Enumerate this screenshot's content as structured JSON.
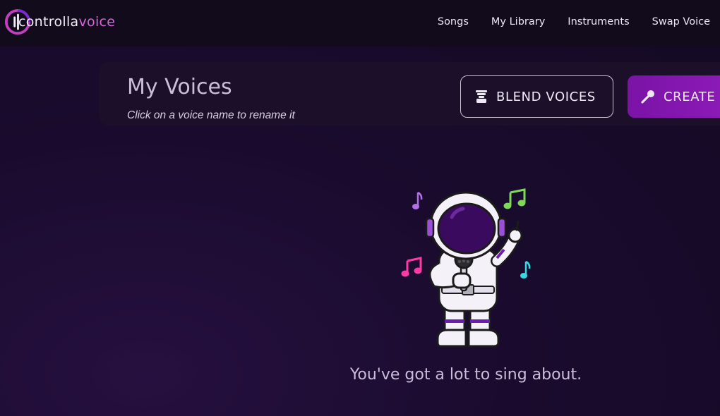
{
  "app": {
    "logo_text_part1": "controlla",
    "logo_text_part2": "voice"
  },
  "nav": {
    "items": [
      {
        "label": "Songs"
      },
      {
        "label": "My Library"
      },
      {
        "label": "Instruments"
      },
      {
        "label": "Swap Voice"
      }
    ]
  },
  "header": {
    "title": "My Voices",
    "subtitle": "Click on a voice name to rename it",
    "blend_label": "BLEND VOICES",
    "create_label": "CREATE"
  },
  "empty_state": {
    "message": "You've got a lot to sing about.",
    "illustration": "singing-astronaut"
  },
  "colors": {
    "background": "#1a0b2e",
    "accent": "#8e1bb8",
    "logo_accent": "#d665d8",
    "note_green": "#7ed957",
    "note_pink": "#ff3aa6",
    "note_purple": "#b070e8",
    "note_cyan": "#38d8e0"
  }
}
